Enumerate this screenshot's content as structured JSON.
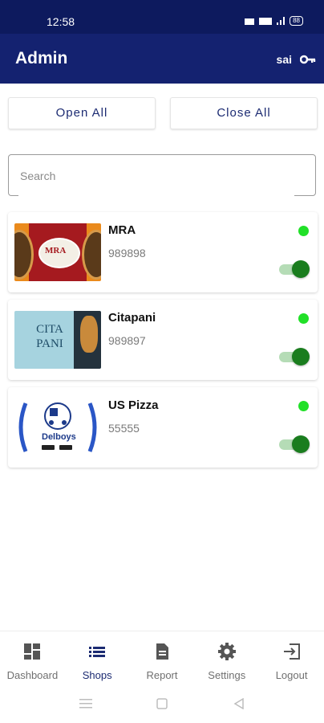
{
  "status_bar": {
    "time": "12:58",
    "battery": "88"
  },
  "header": {
    "title": "Admin",
    "username": "sai",
    "key_icon": "key-icon"
  },
  "actions": {
    "open_all": "Open All",
    "close_all": "Close All"
  },
  "search": {
    "placeholder": "Search",
    "value": ""
  },
  "shops": [
    {
      "name": "MRA",
      "phone": "989898",
      "logo_text": "MRA",
      "online": true,
      "enabled": true
    },
    {
      "name": "Citapani",
      "phone": "989897",
      "logo_text": "CITA PANI",
      "online": true,
      "enabled": true
    },
    {
      "name": "US Pizza",
      "phone": "55555",
      "logo_text": "Delboys",
      "online": true,
      "enabled": true
    }
  ],
  "bottom_nav": [
    {
      "label": "Dashboard",
      "icon": "dashboard-icon"
    },
    {
      "label": "Shops",
      "icon": "list-icon",
      "active": true
    },
    {
      "label": "Report",
      "icon": "report-icon"
    },
    {
      "label": "Settings",
      "icon": "gear-icon"
    },
    {
      "label": "Logout",
      "icon": "logout-icon"
    }
  ],
  "colors": {
    "primary": "#142270",
    "status_bar": "#0d1a5e",
    "online": "#21e028",
    "toggle_on": "#1a7d1e"
  }
}
